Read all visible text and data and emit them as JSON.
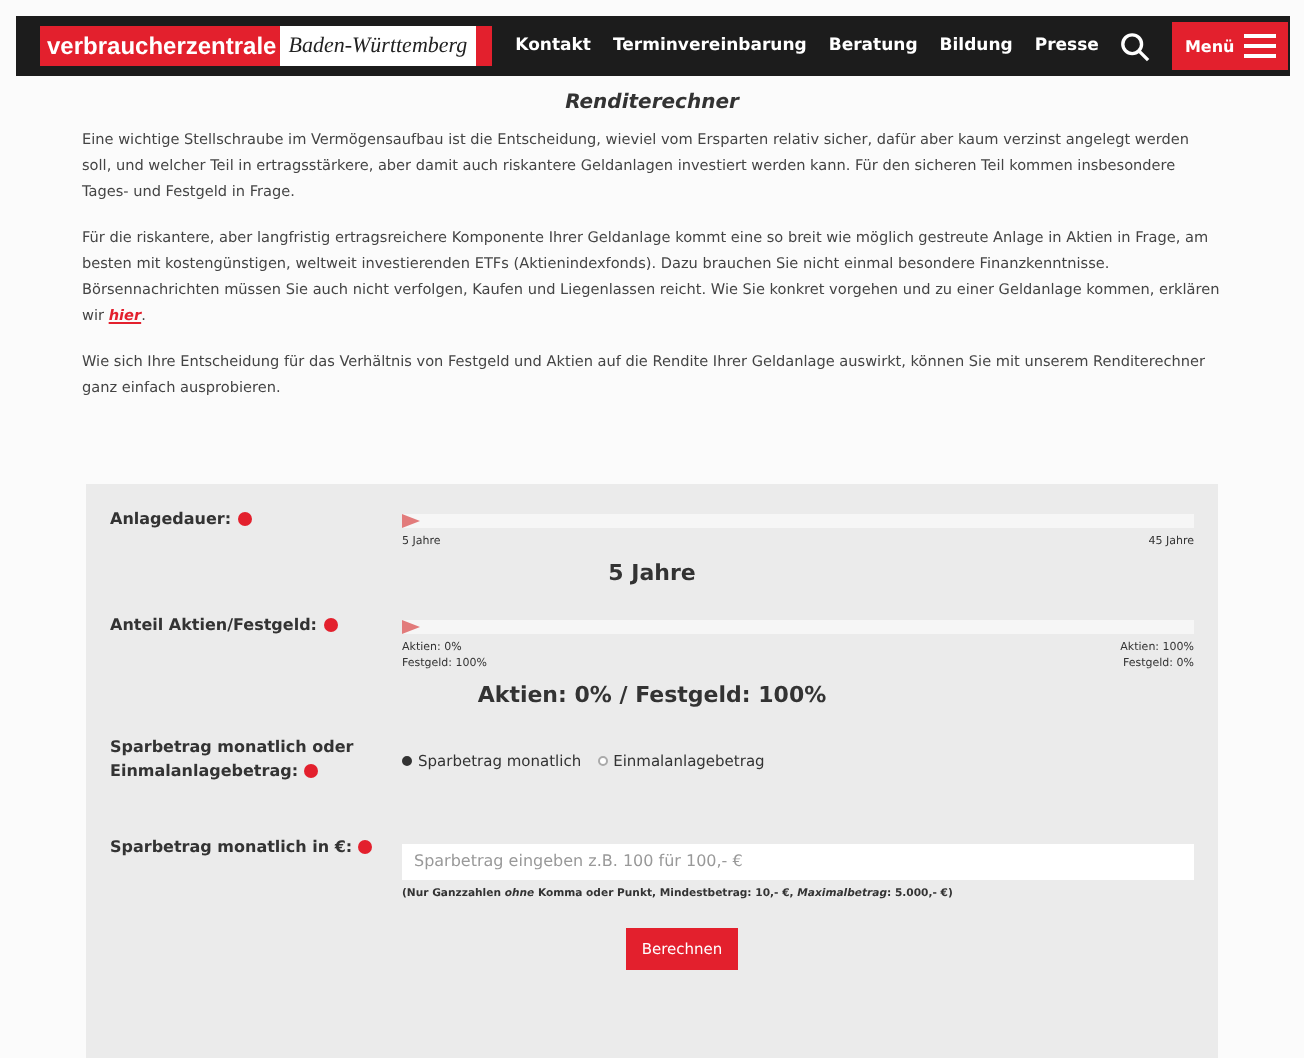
{
  "header": {
    "logo_brand": "verbraucherzentrale",
    "logo_region": "Baden-Württemberg",
    "nav": [
      "Kontakt",
      "Terminvereinbarung",
      "Beratung",
      "Bildung",
      "Presse"
    ],
    "menu_label": "Menü"
  },
  "title": "Renditerechner",
  "paragraphs": [
    {
      "text": "Eine wichtige Stellschraube im Vermögensaufbau ist die Entscheidung, wieviel vom Ersparten relativ sicher, dafür aber kaum verzinst angelegt werden soll, und welcher Teil in ertragsstärkere, aber damit auch riskantere Geldanlagen investiert werden kann. Für den sicheren Teil kommen insbesondere Tages- und Festgeld in Frage."
    },
    {
      "text": "Für die riskantere, aber langfristig ertragsreichere Komponente Ihrer Geldanlage kommt eine so breit wie möglich gestreute Anlage in Aktien in Frage, am besten mit kostengünstigen, weltweit investierenden ETFs (Aktienindexfonds). Dazu brauchen Sie nicht einmal besondere Finanzkenntnisse. Börsennachrichten müssen Sie auch nicht verfolgen, Kaufen und Liegenlassen reicht. Wie Sie konkret vorgehen und zu einer Geldanlage kommen, erklären wir ",
      "link": "hier",
      "after": "."
    },
    {
      "text": "Wie sich Ihre Entscheidung für das Verhältnis von Festgeld und Aktien auf die Rendite Ihrer Geldanlage auswirkt, können Sie mit unserem Renditerechner ganz einfach ausprobieren."
    }
  ],
  "form": {
    "sliders": [
      {
        "label": "Anlagedauer:",
        "level": 0,
        "min_labels": [
          "5 Jahre"
        ],
        "max_labels": [
          "45 Jahre"
        ],
        "value": "5 Jahre"
      },
      {
        "label": "Anteil Aktien/Festgeld:",
        "level": 0,
        "min_labels": [
          "Aktien: 0%",
          "Festgeld: 100%"
        ],
        "max_labels": [
          "Aktien: 100%",
          "Festgeld: 0%"
        ],
        "value": "Aktien: 0% / Festgeld: 100%"
      }
    ],
    "mode": {
      "label": "Sparbetrag monatlich oder Einmalanlagebetrag:",
      "options": [
        {
          "label": "Sparbetrag monatlich",
          "selected": true
        },
        {
          "label": "Einmalanlagebetrag",
          "selected": false
        }
      ]
    },
    "amount": {
      "label": "Sparbetrag monatlich in €:",
      "placeholder": "Sparbetrag eingeben z.B. 100 für 100,- €",
      "hint": "(Nur Ganzzahlen *ohne* Komma oder Punkt, Mindestbetrag: 10,- €, *Maximalbetrag*: 5.000,- €)"
    },
    "submit": "Berechnen"
  }
}
